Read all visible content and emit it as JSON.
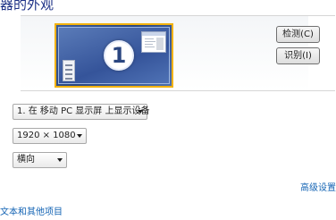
{
  "header": {
    "title": "器的外观"
  },
  "preview": {
    "monitor_number": "1"
  },
  "buttons": {
    "detect_label": "检测(C)",
    "identify_label": "识别(I)"
  },
  "settings": {
    "display_select": "1. 在 移动 PC 显示屏 上显示设备",
    "resolution_select": "1920 × 1080",
    "orientation_select": "横向"
  },
  "links": {
    "advanced_settings": "高级设置",
    "text_and_other_items": "文本和其他项目"
  },
  "colors": {
    "accent_border": "#f2b20c",
    "monitor_blue": "#3b5c9a",
    "link": "#1464b4"
  }
}
